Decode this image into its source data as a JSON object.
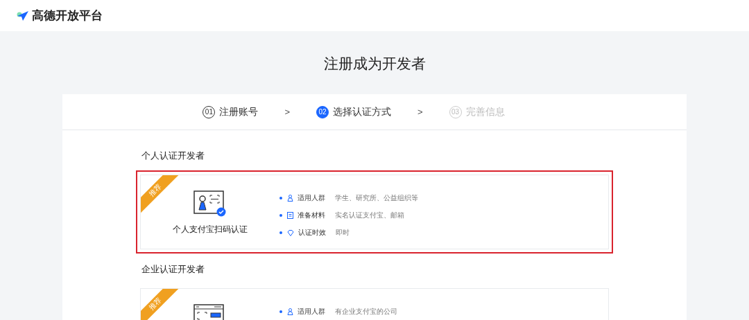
{
  "header": {
    "logo_text": "高德开放平台"
  },
  "page_title": "注册成为开发者",
  "steps": [
    {
      "number": "01",
      "label": "注册账号",
      "selected": false,
      "disabled": false
    },
    {
      "number": "02",
      "label": "选择认证方式",
      "selected": true,
      "disabled": false
    },
    {
      "number": "03",
      "label": "完善信息",
      "selected": false,
      "disabled": true
    }
  ],
  "step_separator": ">",
  "sections": [
    {
      "heading": "个人认证开发者",
      "cards": [
        {
          "kind": "personal",
          "ribbon": "推荐",
          "title": "个人支付宝扫码认证",
          "selected": true,
          "rows": [
            {
              "kind": "audience",
              "label": "适用人群",
              "value": "学生、研究所、公益组织等"
            },
            {
              "kind": "materials",
              "label": "准备材料",
              "value": "实名认证支付宝、邮箱"
            },
            {
              "kind": "time",
              "label": "认证时效",
              "value": "即时"
            }
          ]
        }
      ]
    },
    {
      "heading": "企业认证开发者",
      "cards": [
        {
          "kind": "company",
          "ribbon": "推荐",
          "selected": false,
          "rows": [
            {
              "kind": "audience",
              "label": "适用人群",
              "value": "有企业支付宝的公司"
            }
          ]
        }
      ]
    }
  ]
}
